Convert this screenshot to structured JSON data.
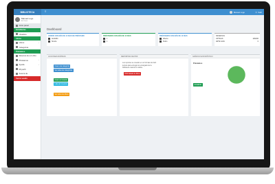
{
  "topbar": {
    "brand": "BIBLIOTECA",
    "menu_icon": "bars-icon",
    "user_name": "Manuel Lugo",
    "logout_label": "Salir"
  },
  "sidebar": {
    "user": {
      "name": "Manuel Lugo",
      "status": "En línea"
    },
    "items": [
      {
        "label": "Inicio panel",
        "icon": "home-icon"
      },
      {
        "header": "Estudiantes"
      },
      {
        "label": "Usuarios",
        "icon": "users-icon",
        "caret": true
      },
      {
        "header": "Libros"
      },
      {
        "label": "Libros",
        "icon": "book-icon",
        "caret": true
      },
      {
        "label": "Categorías",
        "icon": "tag-icon"
      },
      {
        "header": "Préstamos"
      },
      {
        "label": "Reserva de un Libro",
        "icon": "bookmark-icon"
      },
      {
        "label": "Préstamos",
        "icon": "exchange-icon",
        "caret": true
      },
      {
        "label": "Ayuda",
        "icon": "help-icon",
        "caret": true
      },
      {
        "label": "Mi perfil",
        "icon": "user-icon"
      },
      {
        "label": "Acerca de",
        "icon": "info-icon"
      },
      {
        "header": "Cerrar sesión",
        "danger": true
      }
    ]
  },
  "page": {
    "title": "Dashboard"
  },
  "stats": [
    {
      "title": "LIBROS CON MÁS DE 10 DÍAS DE PRÉSTAMO",
      "rows": [
        "ALFARO",
        "Sinuhé"
      ]
    },
    {
      "title": "PRÉSTAMOS CON MÁS DE 10 DÍAS",
      "rows": [
        "1",
        "1"
      ]
    },
    {
      "title": "PRÉSTAMOS CON MÁS DE 10 DÍAS",
      "rows": [
        "Alberto",
        "Pedro"
      ]
    },
    {
      "title": "RESERVAS",
      "rows": [
        [
          "OPTICAS",
          "MAIKIR"
        ],
        [
          "ARTE GUIA",
          "0"
        ]
      ]
    }
  ],
  "panels": {
    "actions": {
      "title": "ACCIONES RÁPIDAS",
      "buttons": [
        "Crear una categoría",
        "Ver todas las categorías",
        "Crear un Usuario",
        "Lista de Usuarios",
        "Ver todos los libros"
      ]
    },
    "reports": {
      "title": "REPORTES DE PDF",
      "text": [
        "Los reportes se crearán en un formato de fácil",
        "lectura para entregar al encargado de la",
        "biblioteca cuando lo solicite."
      ],
      "button": "PDF listado de libros"
    },
    "chart": {
      "title": "GRÁFICO ESTADÍSTICO",
      "button": "Actualizar"
    }
  },
  "chart_data": {
    "type": "pie",
    "title": "Préstamos",
    "categories": [
      "Préstamos"
    ],
    "values": [
      100
    ],
    "colors": [
      "#5cb85c"
    ]
  }
}
